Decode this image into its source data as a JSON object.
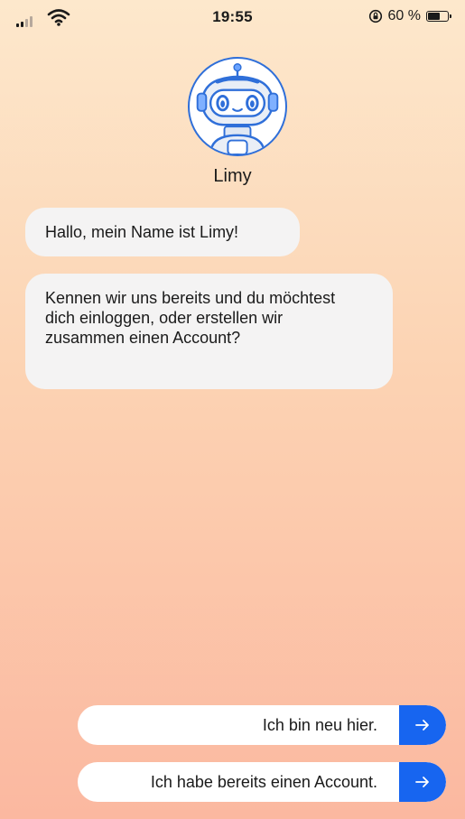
{
  "status_bar": {
    "time": "19:55",
    "battery_text": "60 %",
    "battery_level": 0.6,
    "icons": [
      "signal-icon",
      "wifi-icon",
      "rotation-lock-icon",
      "battery-icon"
    ]
  },
  "bot": {
    "name": "Limy",
    "avatar_icon": "robot-avatar-icon"
  },
  "messages": [
    {
      "text": "Hallo, mein Name ist Limy!"
    },
    {
      "text": "Kennen wir uns bereits und du möchtest dich einloggen, oder erstellen wir zusammen einen Account?"
    }
  ],
  "choices": [
    {
      "label": "Ich bin neu hier.",
      "icon": "arrow-right-icon"
    },
    {
      "label": "Ich habe bereits einen Account.",
      "icon": "arrow-right-icon"
    }
  ],
  "colors": {
    "accent": "#1765f0",
    "bubble": "#f4f3f3",
    "gradient_top": "#fde8cc",
    "gradient_bottom": "#fbb8a0"
  }
}
